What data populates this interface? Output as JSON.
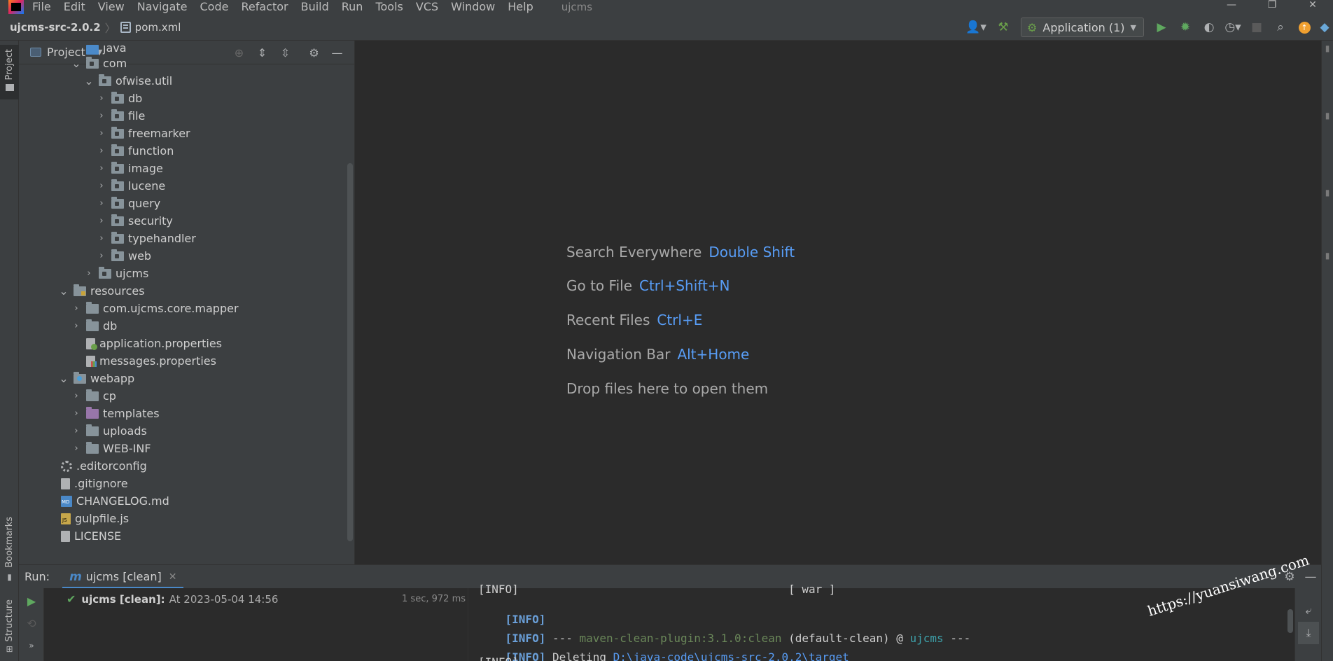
{
  "menubar": {
    "items": [
      "File",
      "Edit",
      "View",
      "Navigate",
      "Code",
      "Refactor",
      "Build",
      "Run",
      "Tools",
      "VCS",
      "Window",
      "Help"
    ],
    "project_title": "ujcms",
    "window_controls": [
      "—",
      "❐",
      "✕"
    ]
  },
  "navbar": {
    "root": "ujcms-src-2.0.2",
    "file": "pom.xml",
    "run_config": "Application (1)"
  },
  "left_stripe": {
    "project": "Project",
    "bookmarks": "Bookmarks",
    "structure": "Structure"
  },
  "project_panel": {
    "title": "Project",
    "tree": [
      {
        "label": "java",
        "depth": 4,
        "arrow": "none",
        "icon": "src"
      },
      {
        "label": "com",
        "depth": 4,
        "arrow": "down",
        "icon": "pkg"
      },
      {
        "label": "ofwise.util",
        "depth": 5,
        "arrow": "down",
        "icon": "pkg"
      },
      {
        "label": "db",
        "depth": 6,
        "arrow": "right",
        "icon": "pkg"
      },
      {
        "label": "file",
        "depth": 6,
        "arrow": "right",
        "icon": "pkg"
      },
      {
        "label": "freemarker",
        "depth": 6,
        "arrow": "right",
        "icon": "pkg"
      },
      {
        "label": "function",
        "depth": 6,
        "arrow": "right",
        "icon": "pkg"
      },
      {
        "label": "image",
        "depth": 6,
        "arrow": "right",
        "icon": "pkg"
      },
      {
        "label": "lucene",
        "depth": 6,
        "arrow": "right",
        "icon": "pkg"
      },
      {
        "label": "query",
        "depth": 6,
        "arrow": "right",
        "icon": "pkg"
      },
      {
        "label": "security",
        "depth": 6,
        "arrow": "right",
        "icon": "pkg"
      },
      {
        "label": "typehandler",
        "depth": 6,
        "arrow": "right",
        "icon": "pkg"
      },
      {
        "label": "web",
        "depth": 6,
        "arrow": "right",
        "icon": "pkg"
      },
      {
        "label": "ujcms",
        "depth": 5,
        "arrow": "right",
        "icon": "pkg"
      },
      {
        "label": "resources",
        "depth": 3,
        "arrow": "down",
        "icon": "res"
      },
      {
        "label": "com.ujcms.core.mapper",
        "depth": 4,
        "arrow": "right",
        "icon": "folder"
      },
      {
        "label": "db",
        "depth": 4,
        "arrow": "right",
        "icon": "folder"
      },
      {
        "label": "application.properties",
        "depth": 4,
        "arrow": "none",
        "icon": "props"
      },
      {
        "label": "messages.properties",
        "depth": 4,
        "arrow": "none",
        "icon": "msgs"
      },
      {
        "label": "webapp",
        "depth": 3,
        "arrow": "down",
        "icon": "web"
      },
      {
        "label": "cp",
        "depth": 4,
        "arrow": "right",
        "icon": "folder"
      },
      {
        "label": "templates",
        "depth": 4,
        "arrow": "right",
        "icon": "tpl"
      },
      {
        "label": "uploads",
        "depth": 4,
        "arrow": "right",
        "icon": "folder"
      },
      {
        "label": "WEB-INF",
        "depth": 4,
        "arrow": "right",
        "icon": "folder"
      },
      {
        "label": ".editorconfig",
        "depth": 2,
        "arrow": "none",
        "icon": "gear"
      },
      {
        "label": ".gitignore",
        "depth": 2,
        "arrow": "none",
        "icon": "git"
      },
      {
        "label": "CHANGELOG.md",
        "depth": 2,
        "arrow": "none",
        "icon": "md"
      },
      {
        "label": "gulpfile.js",
        "depth": 2,
        "arrow": "none",
        "icon": "js"
      },
      {
        "label": "LICENSE",
        "depth": 2,
        "arrow": "none",
        "icon": "txt"
      }
    ]
  },
  "editor_hints": [
    {
      "text": "Search Everywhere",
      "key": "Double Shift"
    },
    {
      "text": "Go to File",
      "key": "Ctrl+Shift+N"
    },
    {
      "text": "Recent Files",
      "key": "Ctrl+E"
    },
    {
      "text": "Navigation Bar",
      "key": "Alt+Home"
    },
    {
      "text": "Drop files here to open them",
      "key": ""
    }
  ],
  "run_panel": {
    "label": "Run:",
    "tab": "ujcms [clean]",
    "tab_letter": "m",
    "row_name": "ujcms [clean]:",
    "row_time": "At 2023-05-04 14:56",
    "row_duration": "1 sec, 972 ms",
    "console": {
      "partial_top": "[INFO]                                        [ war ]",
      "l1_tag": "[INFO]",
      "l2_tag": "[INFO]",
      "l2_dashes": " --- ",
      "l2_plugin": "maven-clean-plugin:3.1.0:clean",
      "l2_rest": " (default-clean) @ ",
      "l2_project": "ujcms",
      "l2_tail": " ---",
      "l3_tag": "[INFO]",
      "l3_text": " Deleting ",
      "l3_link": "D:\\java-code\\ujcms-src-2.0.2\\target",
      "partial_bottom": "[INFO]"
    }
  },
  "watermark": "https://yuansiwang.com"
}
